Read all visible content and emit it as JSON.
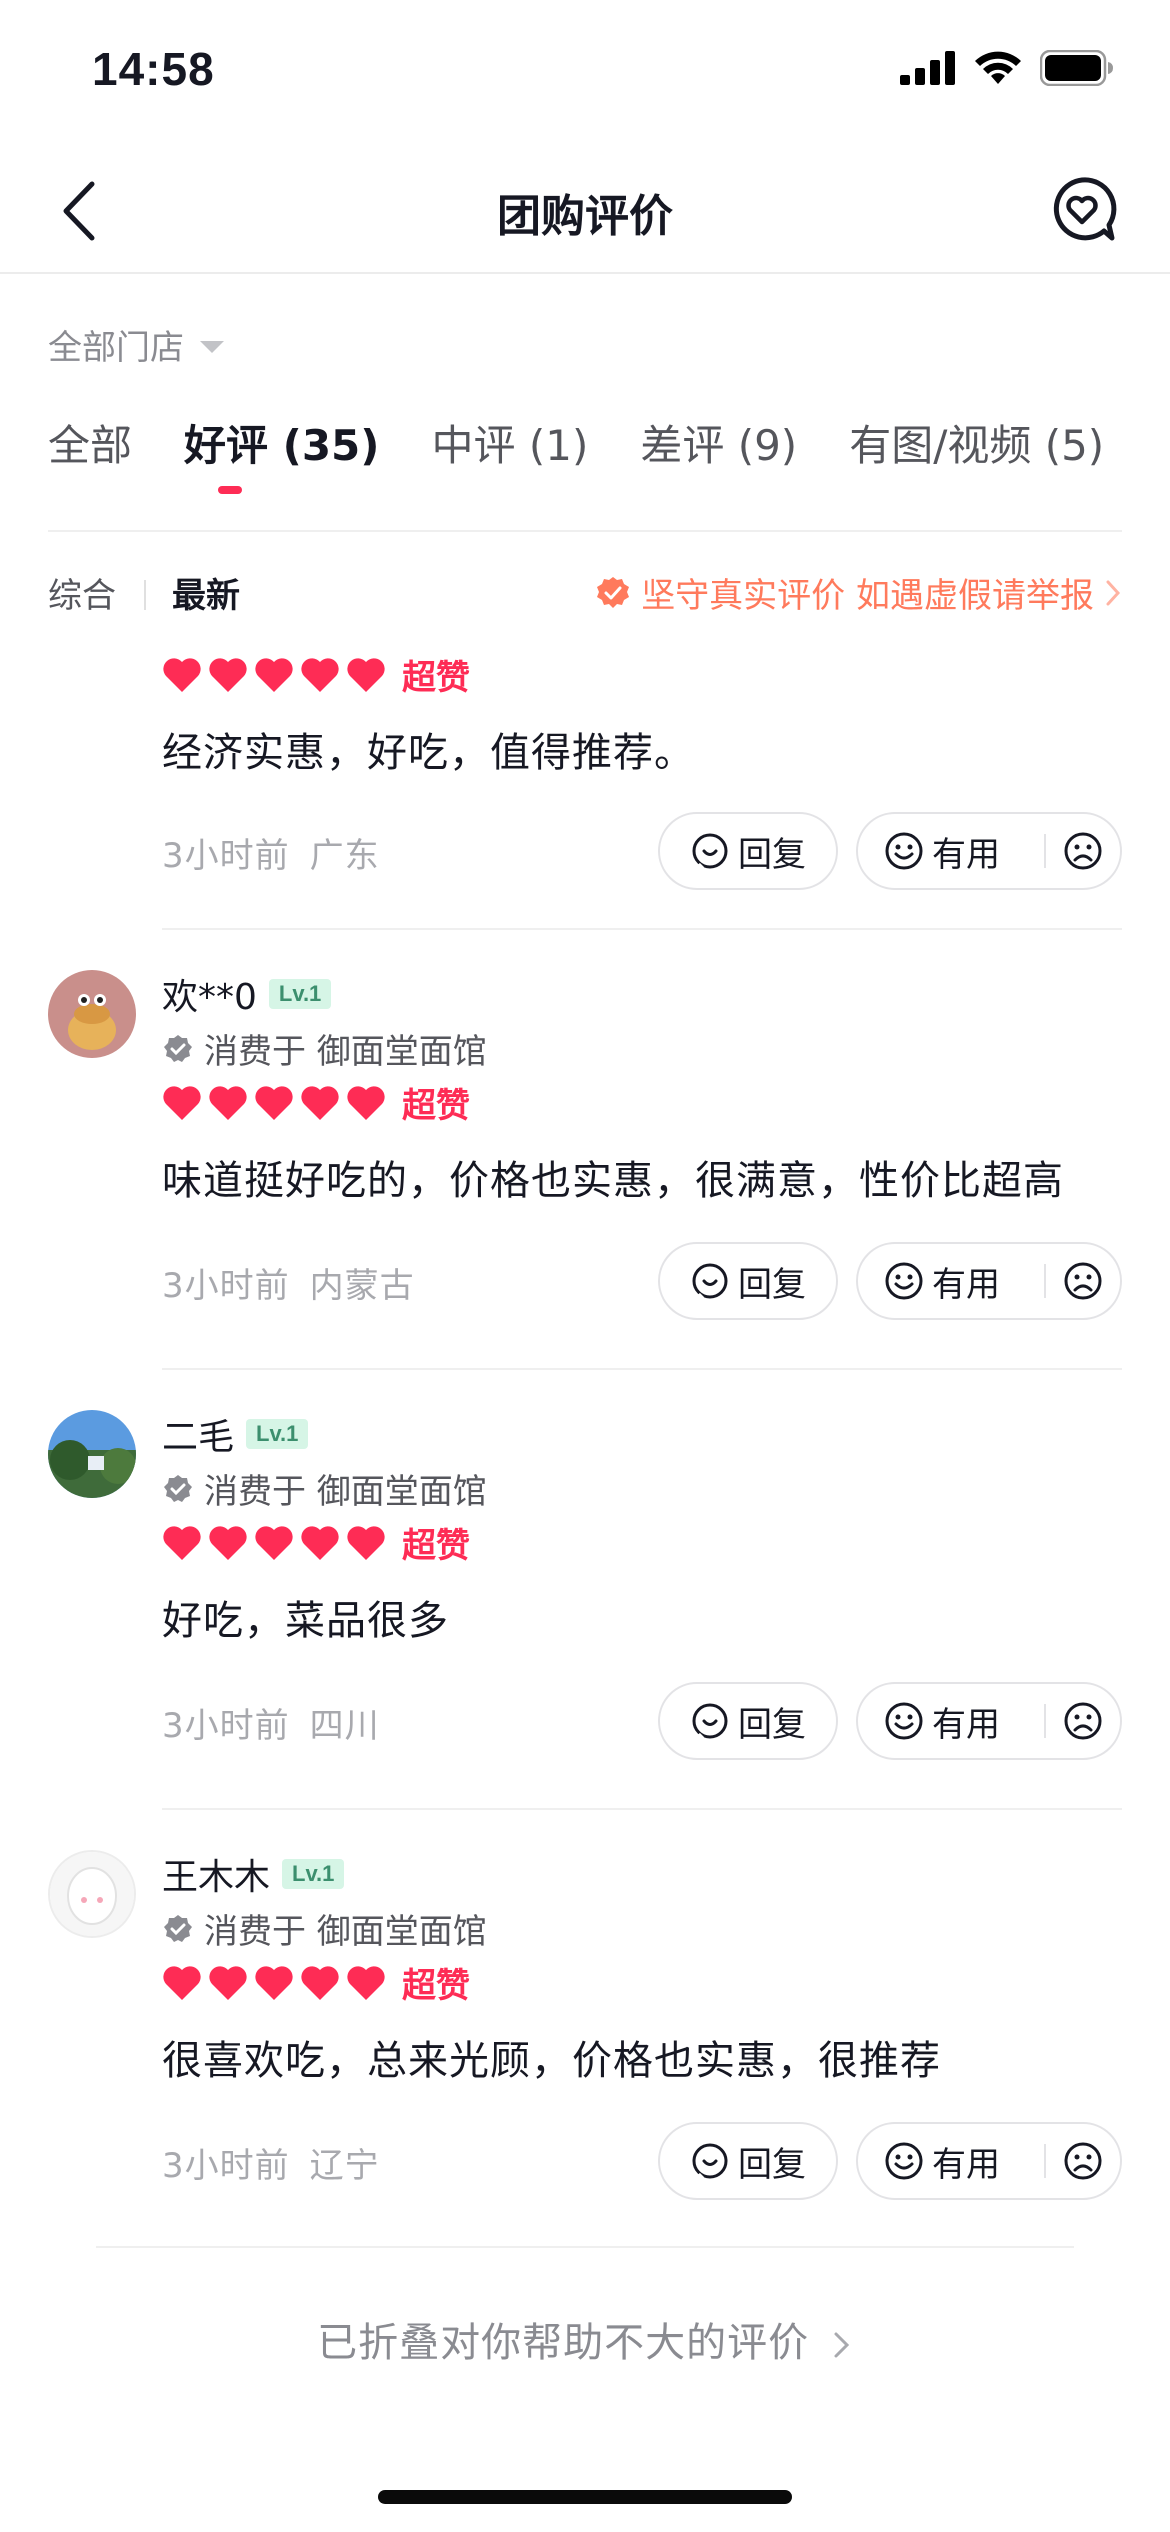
{
  "status_bar": {
    "time": "14:58"
  },
  "nav": {
    "title": "团购评价"
  },
  "store_filter": {
    "label": "全部门店"
  },
  "tabs": [
    {
      "label": "全部",
      "active": false
    },
    {
      "label": "好评 (35)",
      "active": true
    },
    {
      "label": "中评 (1)",
      "active": false
    },
    {
      "label": "差评 (9)",
      "active": false
    },
    {
      "label": "有图/视频 (5)",
      "active": false
    }
  ],
  "sort": {
    "comprehensive": "综合",
    "latest": "最新"
  },
  "notice": {
    "text": "坚守真实评价 如遇虚假请举报"
  },
  "action_labels": {
    "reply": "回复",
    "useful": "有用"
  },
  "rating_label": "超赞",
  "reviews": [
    {
      "comment": "经济实惠，好吃，值得推荐。",
      "time": "3小时前",
      "location": "广东"
    },
    {
      "username": "欢**0",
      "level": "Lv.1",
      "consumed_at": "消费于 御面堂面馆",
      "comment": "味道挺好吃的，价格也实惠，很满意，性价比超高",
      "time": "3小时前",
      "location": "内蒙古"
    },
    {
      "username": "二毛",
      "level": "Lv.1",
      "consumed_at": "消费于 御面堂面馆",
      "comment": "好吃，菜品很多",
      "time": "3小时前",
      "location": "四川"
    },
    {
      "username": "王木木",
      "level": "Lv.1",
      "consumed_at": "消费于 御面堂面馆",
      "comment": "很喜欢吃，总来光顾，价格也实惠，很推荐",
      "time": "3小时前",
      "location": "辽宁"
    }
  ],
  "folded_link": {
    "text": "已折叠对你帮助不大的评价"
  },
  "colors": {
    "accent": "#fe2c55",
    "notice": "#ff7a5c",
    "level_badge_bg": "#d6f5e6"
  }
}
